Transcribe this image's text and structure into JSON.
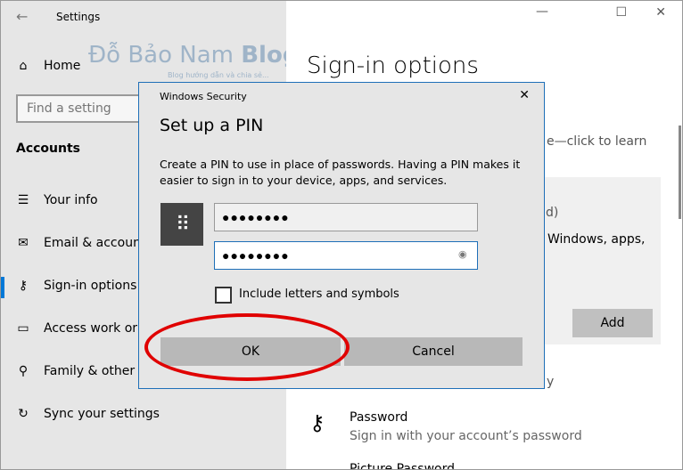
{
  "window": {
    "title": "Settings",
    "minimize": "—",
    "maximize": "☐",
    "close": "✕"
  },
  "watermark": {
    "brand": "Đỗ Bảo Nam Blog",
    "tagline": "Blog hướng dẫn và chia sẻ..."
  },
  "sidebar": {
    "home": "Home",
    "search_placeholder": "Find a setting",
    "section": "Accounts",
    "items": [
      {
        "label": "Your info",
        "icon": "person-list-icon"
      },
      {
        "label": "Email & accounts",
        "icon": "mail-icon"
      },
      {
        "label": "Sign-in options",
        "icon": "key-icon",
        "selected": true
      },
      {
        "label": "Access work or school",
        "icon": "briefcase-icon"
      },
      {
        "label": "Family & other users",
        "icon": "person-add-icon"
      },
      {
        "label": "Sync your settings",
        "icon": "sync-icon"
      }
    ]
  },
  "main": {
    "title": "Sign-in options",
    "learn_text": "e—click to learn",
    "card_text1": "d)",
    "card_text2": "Windows, apps,",
    "add_label": "Add",
    "partial": "y",
    "password_title": "Password",
    "password_desc": "Sign in with your account’s password",
    "picture_password": "Picture Password"
  },
  "dialog": {
    "caption": "Windows Security",
    "title": "Set up a PIN",
    "description": "Create a PIN to use in place of passwords. Having a PIN makes it easier to sign in to your device, apps, and services.",
    "pin_value": "●●●●●●●●",
    "confirm_value": "●●●●●●●●",
    "checkbox_label": "Include letters and symbols",
    "checkbox_checked": false,
    "ok_label": "OK",
    "cancel_label": "Cancel",
    "close": "✕"
  },
  "colors": {
    "accent": "#0078d7",
    "annotation": "#e00000"
  }
}
